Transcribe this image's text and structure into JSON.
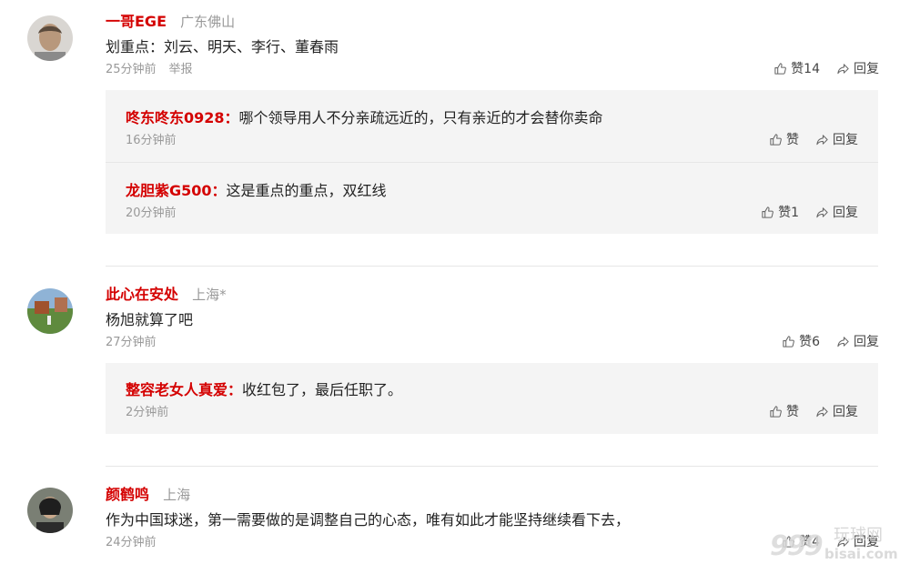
{
  "like_icon": "thumbs-up-icon",
  "reply_icon": "share-arrow-icon",
  "comments": [
    {
      "username": "一哥EGE",
      "location": "广东佛山",
      "text": "划重点：刘云、明天、李行、董春雨",
      "time": "25分钟前",
      "report": "举报",
      "likes": "赞14",
      "reply": "回复",
      "replies": [
        {
          "username": "咚东咚东0928：",
          "text": "哪个领导用人不分亲疏远近的，只有亲近的才会替你卖命",
          "time": "16分钟前",
          "likes": "赞",
          "reply": "回复"
        },
        {
          "username": "龙胆紫G500：",
          "text": "这是重点的重点，双红线",
          "time": "20分钟前",
          "likes": "赞1",
          "reply": "回复"
        }
      ]
    },
    {
      "username": "此心在安处",
      "location": "上海*",
      "text": "杨旭就算了吧",
      "time": "27分钟前",
      "likes": "赞6",
      "reply": "回复",
      "replies": [
        {
          "username": "整容老女人真爱：",
          "text": "收红包了，最后任职了。",
          "time": "2分钟前",
          "likes": "赞",
          "reply": "回复"
        }
      ]
    },
    {
      "username": "颜鹤鸣",
      "location": "上海",
      "text": "作为中国球迷，第一需要做的是调整自己的心态，唯有如此才能坚持继续看下去，",
      "time": "24分钟前",
      "likes": "赞4",
      "reply": "回复"
    }
  ],
  "watermark": {
    "brand_cn": "玩球网",
    "number": "999",
    "url": "bisai.com"
  }
}
